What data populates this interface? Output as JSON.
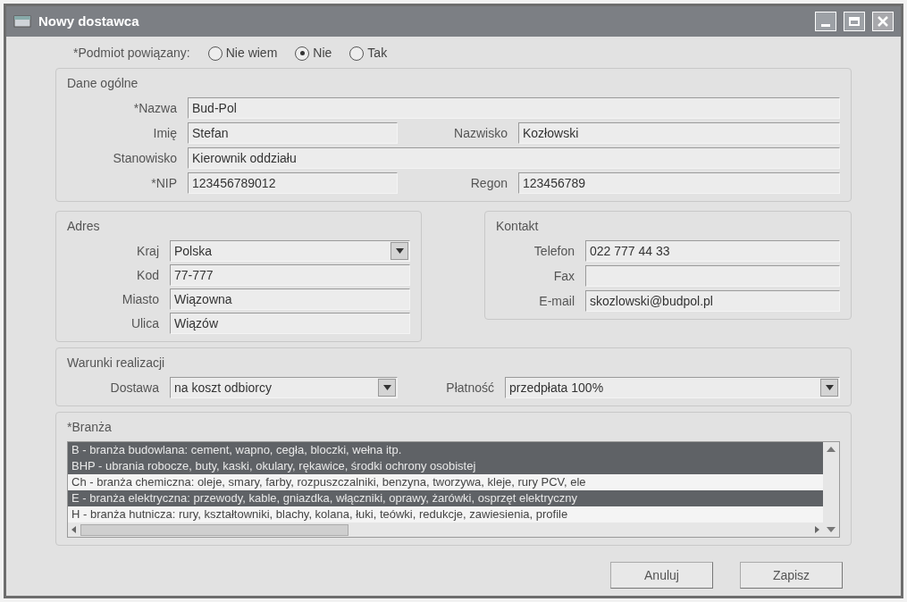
{
  "window": {
    "title": "Nowy dostawca"
  },
  "related": {
    "label": "*Podmiot powiązany:",
    "options": [
      {
        "label": "Nie wiem",
        "selected": false
      },
      {
        "label": "Nie",
        "selected": true
      },
      {
        "label": "Tak",
        "selected": false
      }
    ]
  },
  "general": {
    "title": "Dane ogólne",
    "name": {
      "label": "*Nazwa",
      "value": "Bud-Pol"
    },
    "first_name": {
      "label": "Imię",
      "value": "Stefan"
    },
    "last_name": {
      "label": "Nazwisko",
      "value": "Kozłowski"
    },
    "position": {
      "label": "Stanowisko",
      "value": "Kierownik oddziału"
    },
    "nip": {
      "label": "*NIP",
      "value": "123456789012"
    },
    "regon": {
      "label": "Regon",
      "value": "123456789"
    }
  },
  "address": {
    "title": "Adres",
    "fields": [
      {
        "label": "Kraj",
        "value": "Polska",
        "kind": "dropdown"
      },
      {
        "label": "Kod",
        "value": "77-777",
        "kind": "text"
      },
      {
        "label": "Miasto",
        "value": "Wiązowna",
        "kind": "text"
      },
      {
        "label": "Ulica",
        "value": "Wiązów",
        "kind": "text"
      }
    ]
  },
  "contact": {
    "title": "Kontakt",
    "fields": [
      {
        "label": "Telefon",
        "value": "022 777 44 33"
      },
      {
        "label": "Fax"
      },
      {
        "label": "E-mail",
        "value": "skozlowski@budpol.pl"
      }
    ]
  },
  "terms": {
    "title": "Warunki realizacji",
    "delivery": {
      "label": "Dostawa",
      "value": "na koszt odbiorcy"
    },
    "payment": {
      "label": "Płatność",
      "value": "przedpłata 100%"
    }
  },
  "industry": {
    "title": "*Branża",
    "items": [
      {
        "text": "B - branża budowlana: cement, wapno, cegła, bloczki, wełna itp.",
        "selected": true
      },
      {
        "text": "BHP - ubrania robocze, buty, kaski, okulary, rękawice, środki ochrony osobistej",
        "selected": true
      },
      {
        "text": "Ch - branża chemiczna: oleje, smary, farby, rozpuszczalniki, benzyna, tworzywa, kleje, rury PCV, ele",
        "selected": false
      },
      {
        "text": "E - branża elektryczna: przewody, kable, gniazdka, włączniki, oprawy, żarówki, osprzęt elektryczny",
        "selected": true
      },
      {
        "text": "H - branża hutnicza: rury, kształtowniki, blachy, kolana, łuki, teówki, redukcje, zawiesienia, profile",
        "selected": false
      }
    ]
  },
  "buttons": [
    "Anuluj",
    "Zapisz"
  ]
}
